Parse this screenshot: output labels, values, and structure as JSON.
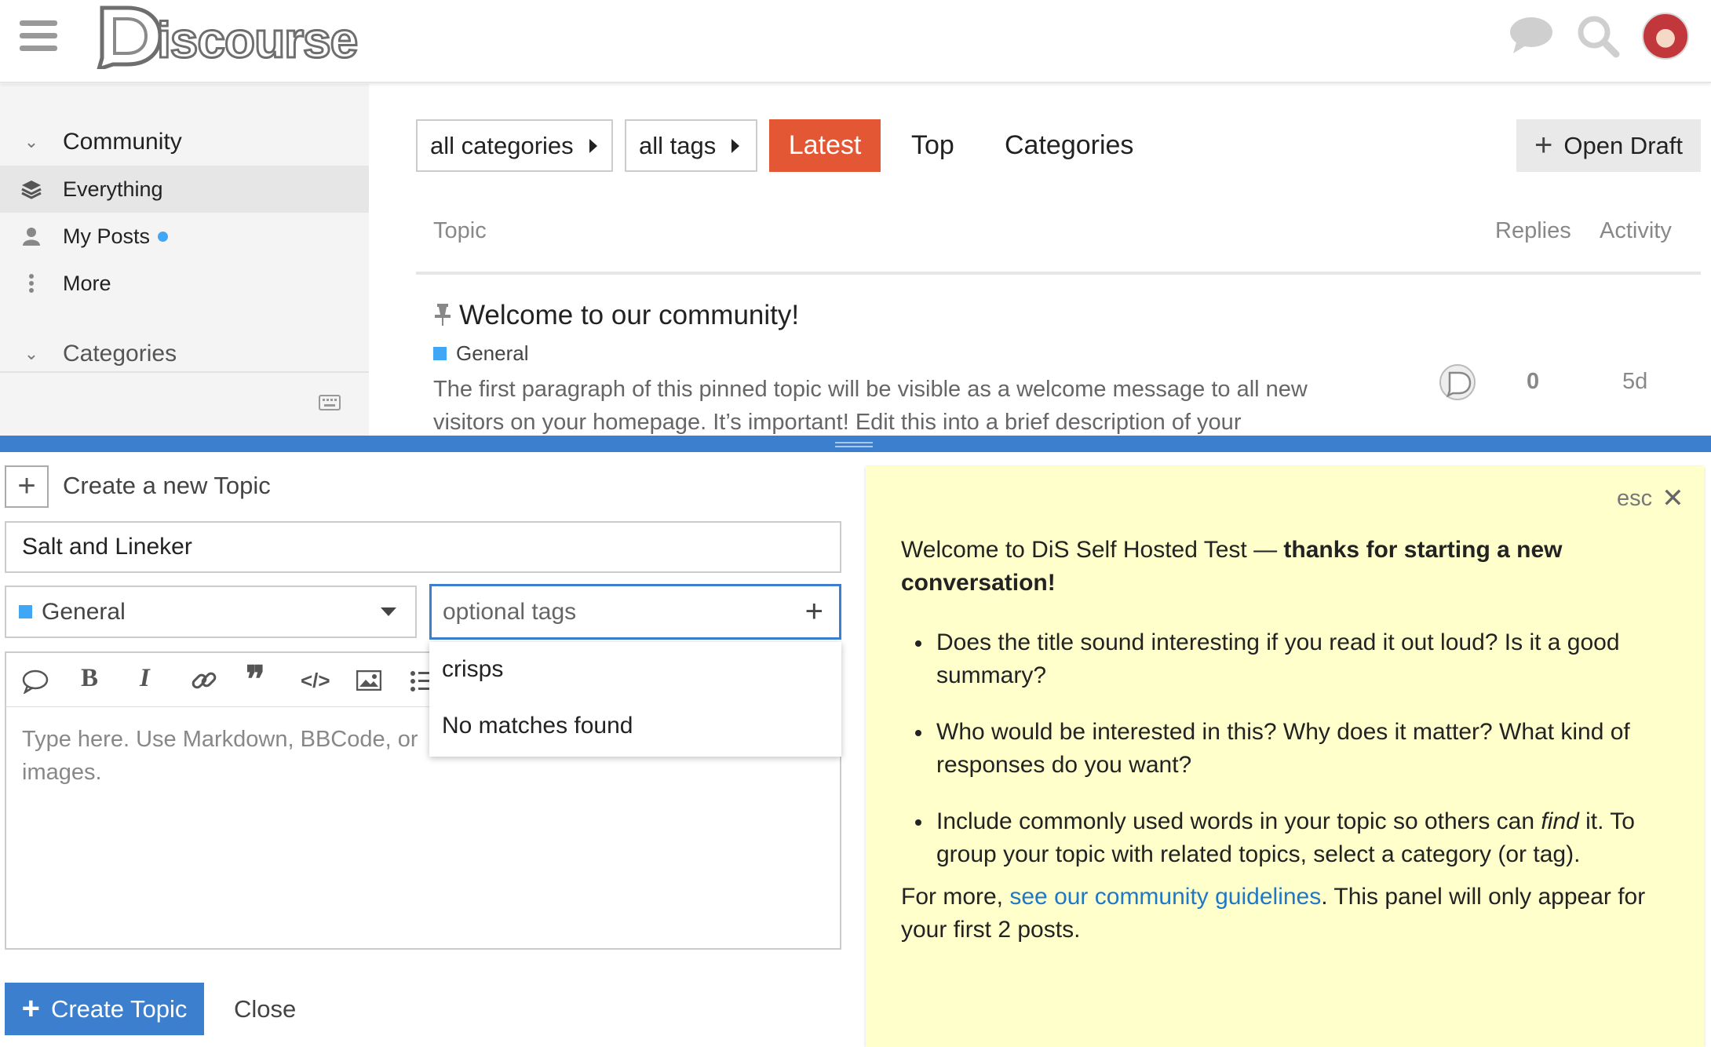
{
  "header": {
    "logo_text": "iscourse"
  },
  "sidebar": {
    "section_community": "Community",
    "items": [
      {
        "label": "Everything",
        "icon": "layers-icon"
      },
      {
        "label": "My Posts",
        "icon": "user-icon"
      },
      {
        "label": "More",
        "icon": "vertical-ellipsis-icon"
      }
    ],
    "section_categories": "Categories"
  },
  "nav": {
    "categories_filter": "all categories",
    "tags_filter": "all tags",
    "latest": "Latest",
    "top": "Top",
    "categories": "Categories",
    "open_draft": "Open Draft"
  },
  "topics_table": {
    "headers": [
      "Topic",
      "Replies",
      "Activity"
    ],
    "rows": [
      {
        "title": "Welcome to our community!",
        "category": "General",
        "excerpt_line1": "The first paragraph of this pinned topic will be visible as a welcome message to all new",
        "excerpt_line2": "visitors on your homepage. It’s important! Edit this into a brief description of your",
        "replies": "0",
        "activity": "5d"
      }
    ]
  },
  "composer": {
    "action_label": "Create a new Topic",
    "title_value": "Salt and Lineker",
    "category_value": "General",
    "tags_placeholder": "optional tags",
    "tag_suggestions": [
      "crisps",
      "No matches found"
    ],
    "editor_placeholder_line1": "Type here. Use Markdown, BBCode, or",
    "editor_placeholder_line2": "images.",
    "create_button": "Create Topic",
    "close_button": "Close"
  },
  "education": {
    "esc_label": "esc",
    "intro_plain": "Welcome to DiS Self Hosted Test — ",
    "intro_bold_1": "thanks for starting a new",
    "intro_bold_2": "conversation!",
    "bullets": [
      {
        "line1": "Does the title sound interesting if you read it out loud? Is it a good",
        "line2": "summary?"
      },
      {
        "line1": "Who would be interested in this? Why does it matter? What kind of",
        "line2": "responses do you want?"
      },
      {
        "line1_a": "Include commonly used words in your topic so others can ",
        "line1_em": "find",
        "line1_b": " it. To",
        "line2": "group your topic with related topics, select a category (or tag)."
      }
    ],
    "footer_a": "For more, ",
    "footer_link": "see our community guidelines",
    "footer_b": ". This panel will only appear for",
    "footer_line2": "your first 2 posts."
  },
  "colors": {
    "accent_latest": "#e45735",
    "primary_blue": "#3b7fce",
    "category_general": "#3fa7f5",
    "education_bg": "#ffffcc"
  }
}
